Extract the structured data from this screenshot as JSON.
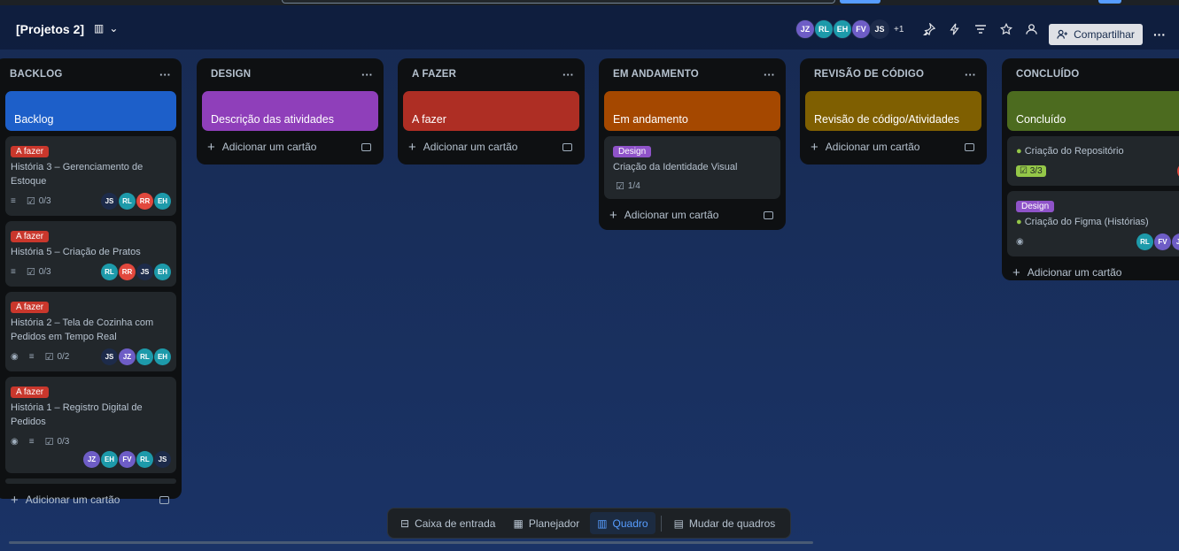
{
  "board": {
    "title": "[Projetos 2]"
  },
  "header": {
    "members": [
      {
        "initials": "JZ",
        "color": "#6e5dc6"
      },
      {
        "initials": "RL",
        "color": "#1d9aaa"
      },
      {
        "initials": "EH",
        "color": "#1d9aaa"
      },
      {
        "initials": "FV",
        "color": "#6e5dc6"
      },
      {
        "initials": "JS",
        "color": "#1d2b4a"
      }
    ],
    "more_members": "+1",
    "share_label": "Compartilhar",
    "icons": [
      "power-up-icon",
      "automation-icon",
      "filter-icon",
      "star-icon",
      "visibility-icon"
    ]
  },
  "lists": [
    {
      "title": "BACKLOG",
      "cover": {
        "label": "Backlog",
        "color": "#1d5fc9"
      },
      "cards": [
        {
          "label": "A fazer",
          "title": "História 3 – Gerenciamento de Estoque",
          "badges": {
            "desc": true,
            "checklist": "0/3"
          },
          "avatars": [
            {
              "initials": "JS",
              "color": "#1d2b4a"
            },
            {
              "initials": "RL",
              "color": "#1d9aaa"
            },
            {
              "initials": "RR",
              "color": "#e2483d"
            },
            {
              "initials": "EH",
              "color": "#1d9aaa"
            }
          ]
        },
        {
          "label": "A fazer",
          "title": "História 5 – Criação de Pratos",
          "badges": {
            "desc": true,
            "checklist": "0/3"
          },
          "avatars": [
            {
              "initials": "RL",
              "color": "#1d9aaa"
            },
            {
              "initials": "RR",
              "color": "#e2483d"
            },
            {
              "initials": "JS",
              "color": "#1d2b4a"
            },
            {
              "initials": "EH",
              "color": "#1d9aaa"
            }
          ]
        },
        {
          "label": "A fazer",
          "title": "História 2 – Tela de Cozinha com Pedidos em Tempo Real",
          "badges": {
            "watch": true,
            "desc": true,
            "checklist": "0/2"
          },
          "avatars": [
            {
              "initials": "JS",
              "color": "#1d2b4a"
            },
            {
              "initials": "JZ",
              "color": "#6e5dc6"
            },
            {
              "initials": "RL",
              "color": "#1d9aaa"
            },
            {
              "initials": "EH",
              "color": "#1d9aaa"
            }
          ]
        },
        {
          "label": "A fazer",
          "title": "História 1 – Registro Digital de Pedidos",
          "badges": {
            "watch": true,
            "desc": true,
            "checklist": "0/3"
          },
          "avatars": [
            {
              "initials": "JZ",
              "color": "#6e5dc6"
            },
            {
              "initials": "EH",
              "color": "#1d9aaa"
            },
            {
              "initials": "FV",
              "color": "#6e5dc6"
            },
            {
              "initials": "RL",
              "color": "#1d9aaa"
            },
            {
              "initials": "JS",
              "color": "#1d2b4a"
            }
          ]
        }
      ],
      "add_label": "Adicionar um cartão"
    },
    {
      "title": "DESIGN",
      "cover": {
        "label": "Descrição das atividades",
        "color": "#8f3fba"
      },
      "cards": [],
      "add_label": "Adicionar um cartão"
    },
    {
      "title": "A FAZER",
      "cover": {
        "label": "A fazer",
        "color": "#ae2e24"
      },
      "cards": [],
      "add_label": "Adicionar um cartão"
    },
    {
      "title": "EM ANDAMENTO",
      "cover": {
        "label": "Em andamento",
        "color": "#a54800"
      },
      "cards": [
        {
          "label": "Design",
          "title": "Criação da Identidade Visual",
          "badges": {
            "checklist": "1/4"
          },
          "avatars": []
        }
      ],
      "add_label": "Adicionar um cartão"
    },
    {
      "title": "REVISÃO DE CÓDIGO",
      "cover": {
        "label": "Revisão de código/Atividades",
        "color": "#7f5f01"
      },
      "cards": [],
      "add_label": "Adicionar um cartão"
    },
    {
      "title": "CONCLUÍDO",
      "cover": {
        "label": "Concluído",
        "color": "#4c6b1f"
      },
      "cards": [
        {
          "title": "Criação do Repositório",
          "badges": {
            "checklist": "3/3"
          },
          "avatars": [
            {
              "initials": "RR",
              "color": "#e2483d"
            }
          ]
        },
        {
          "label": "Design",
          "title": "Criação do Figma (Histórias)",
          "badges": {
            "watch": true
          },
          "avatars": [
            {
              "initials": "RL",
              "color": "#1d9aaa"
            },
            {
              "initials": "FV",
              "color": "#6e5dc6"
            },
            {
              "initials": "JZ",
              "color": "#6e5dc6"
            }
          ]
        }
      ],
      "add_label": "Adicionar um cartão"
    }
  ],
  "bottom_nav": {
    "inbox": "Caixa de entrada",
    "planner": "Planejador",
    "board": "Quadro",
    "switch_boards": "Mudar de quadros"
  }
}
